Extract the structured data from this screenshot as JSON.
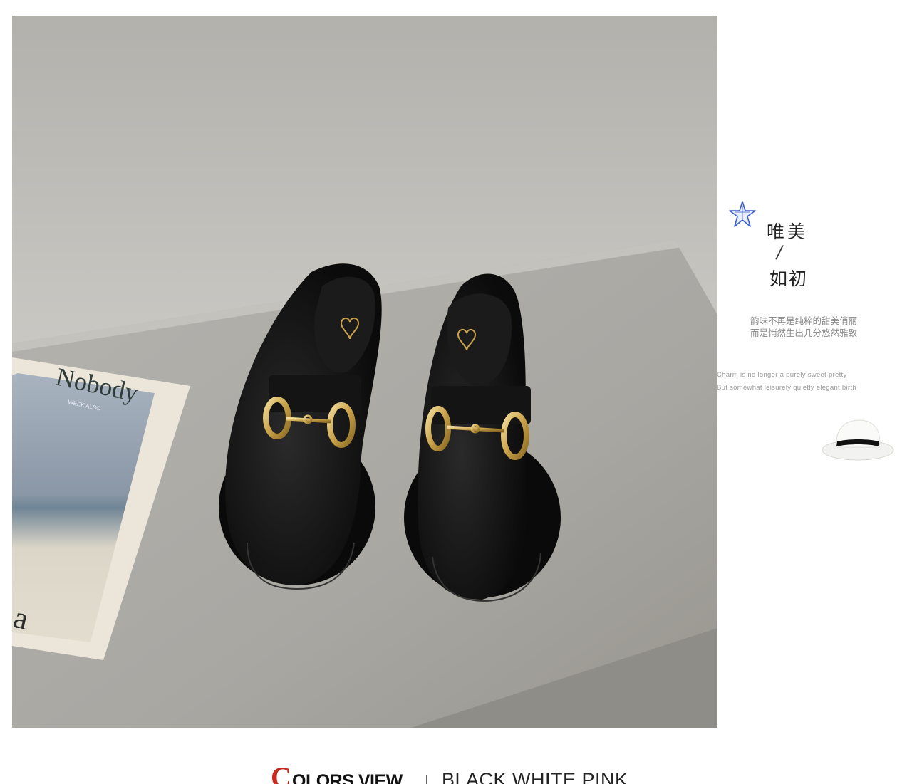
{
  "photo": {
    "book_title": "Nobody",
    "book_subtitle": "WEEK ALSO",
    "book_corner_text": "a"
  },
  "side_panel": {
    "title_line_1": "唯美",
    "separator": "/",
    "title_line_2": "如初",
    "cn_description_line_1": "韵味不再是纯粹的甜美俏丽",
    "cn_description_line_2": "而是悄然生出几分悠然雅致",
    "en_description_line_1": "Charm is no longer a purely sweet pretty",
    "en_description_line_2": "But somewhat leisurely quietly elegant birth",
    "icons": [
      "star-icon",
      "hat-icon"
    ]
  },
  "colors_view": {
    "initial": "C",
    "label": "OLORS VIEW",
    "values": "BLACK  WHITE  PINK"
  },
  "colors": {
    "accent_red": "#c8281e",
    "star_blue": "#3a5fc8",
    "shoe_black": "#111111",
    "buckle_gold": "#c9a24a"
  }
}
